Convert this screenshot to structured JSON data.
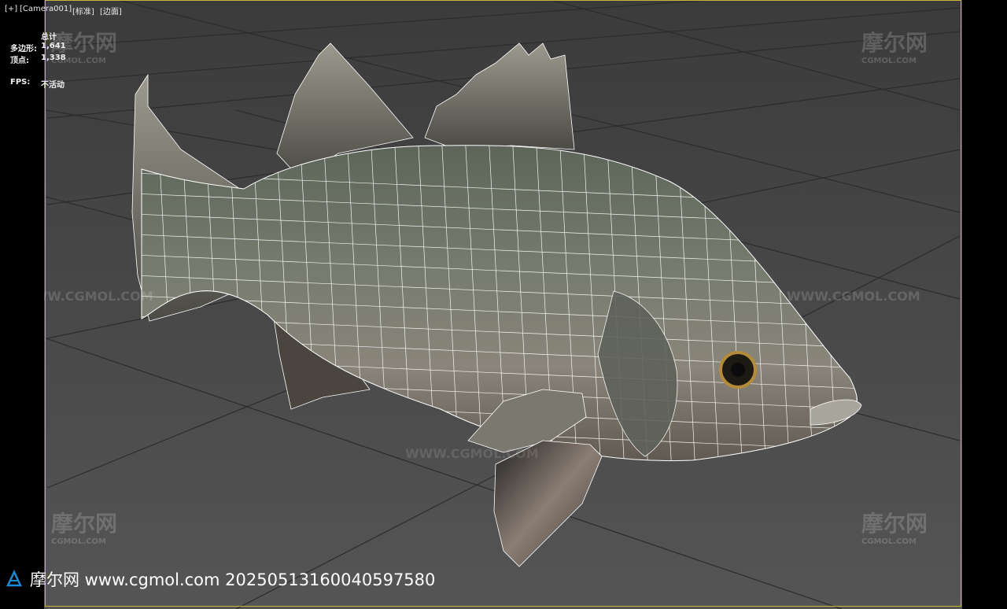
{
  "viewport_menu": {
    "plus": "[+]",
    "camera": "[Camera001]",
    "shading": "[标准]",
    "edges": "[边面]"
  },
  "stats": {
    "total_label": "总计",
    "polys_label": "多边形:",
    "polys_value": "1,641",
    "verts_label": "顶点:",
    "verts_value": "1,338",
    "fps_label": "FPS:",
    "fps_value": "不活动"
  },
  "watermark": {
    "brand_cn": "摩尔网",
    "brand_url_caps": "CGMOL.COM",
    "site_line": "WWW.CGMOL.COM",
    "bottom_text": "摩尔网 www.cgmol.com 20250513160040597580"
  },
  "colors": {
    "viewport_bg": "#444444",
    "frame": "#c8b63a",
    "grid_line": "#2a2a2a",
    "wire": "#ffffff"
  }
}
